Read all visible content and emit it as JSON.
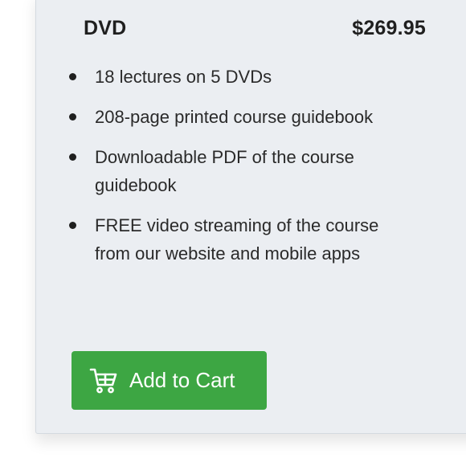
{
  "product_option": {
    "format": "DVD",
    "price": "$269.95",
    "features": [
      "18 lectures on 5 DVDs",
      "208-page printed course guidebook",
      "Downloadable PDF of the course guidebook",
      "FREE video streaming of the course from our website and mobile apps"
    ],
    "add_to_cart_label": "Add to Cart",
    "cart_icon": "shopping-cart-icon"
  },
  "colors": {
    "card_background": "#ebeef2",
    "button_green": "#3da643",
    "text_dark": "#1f1f1f"
  }
}
